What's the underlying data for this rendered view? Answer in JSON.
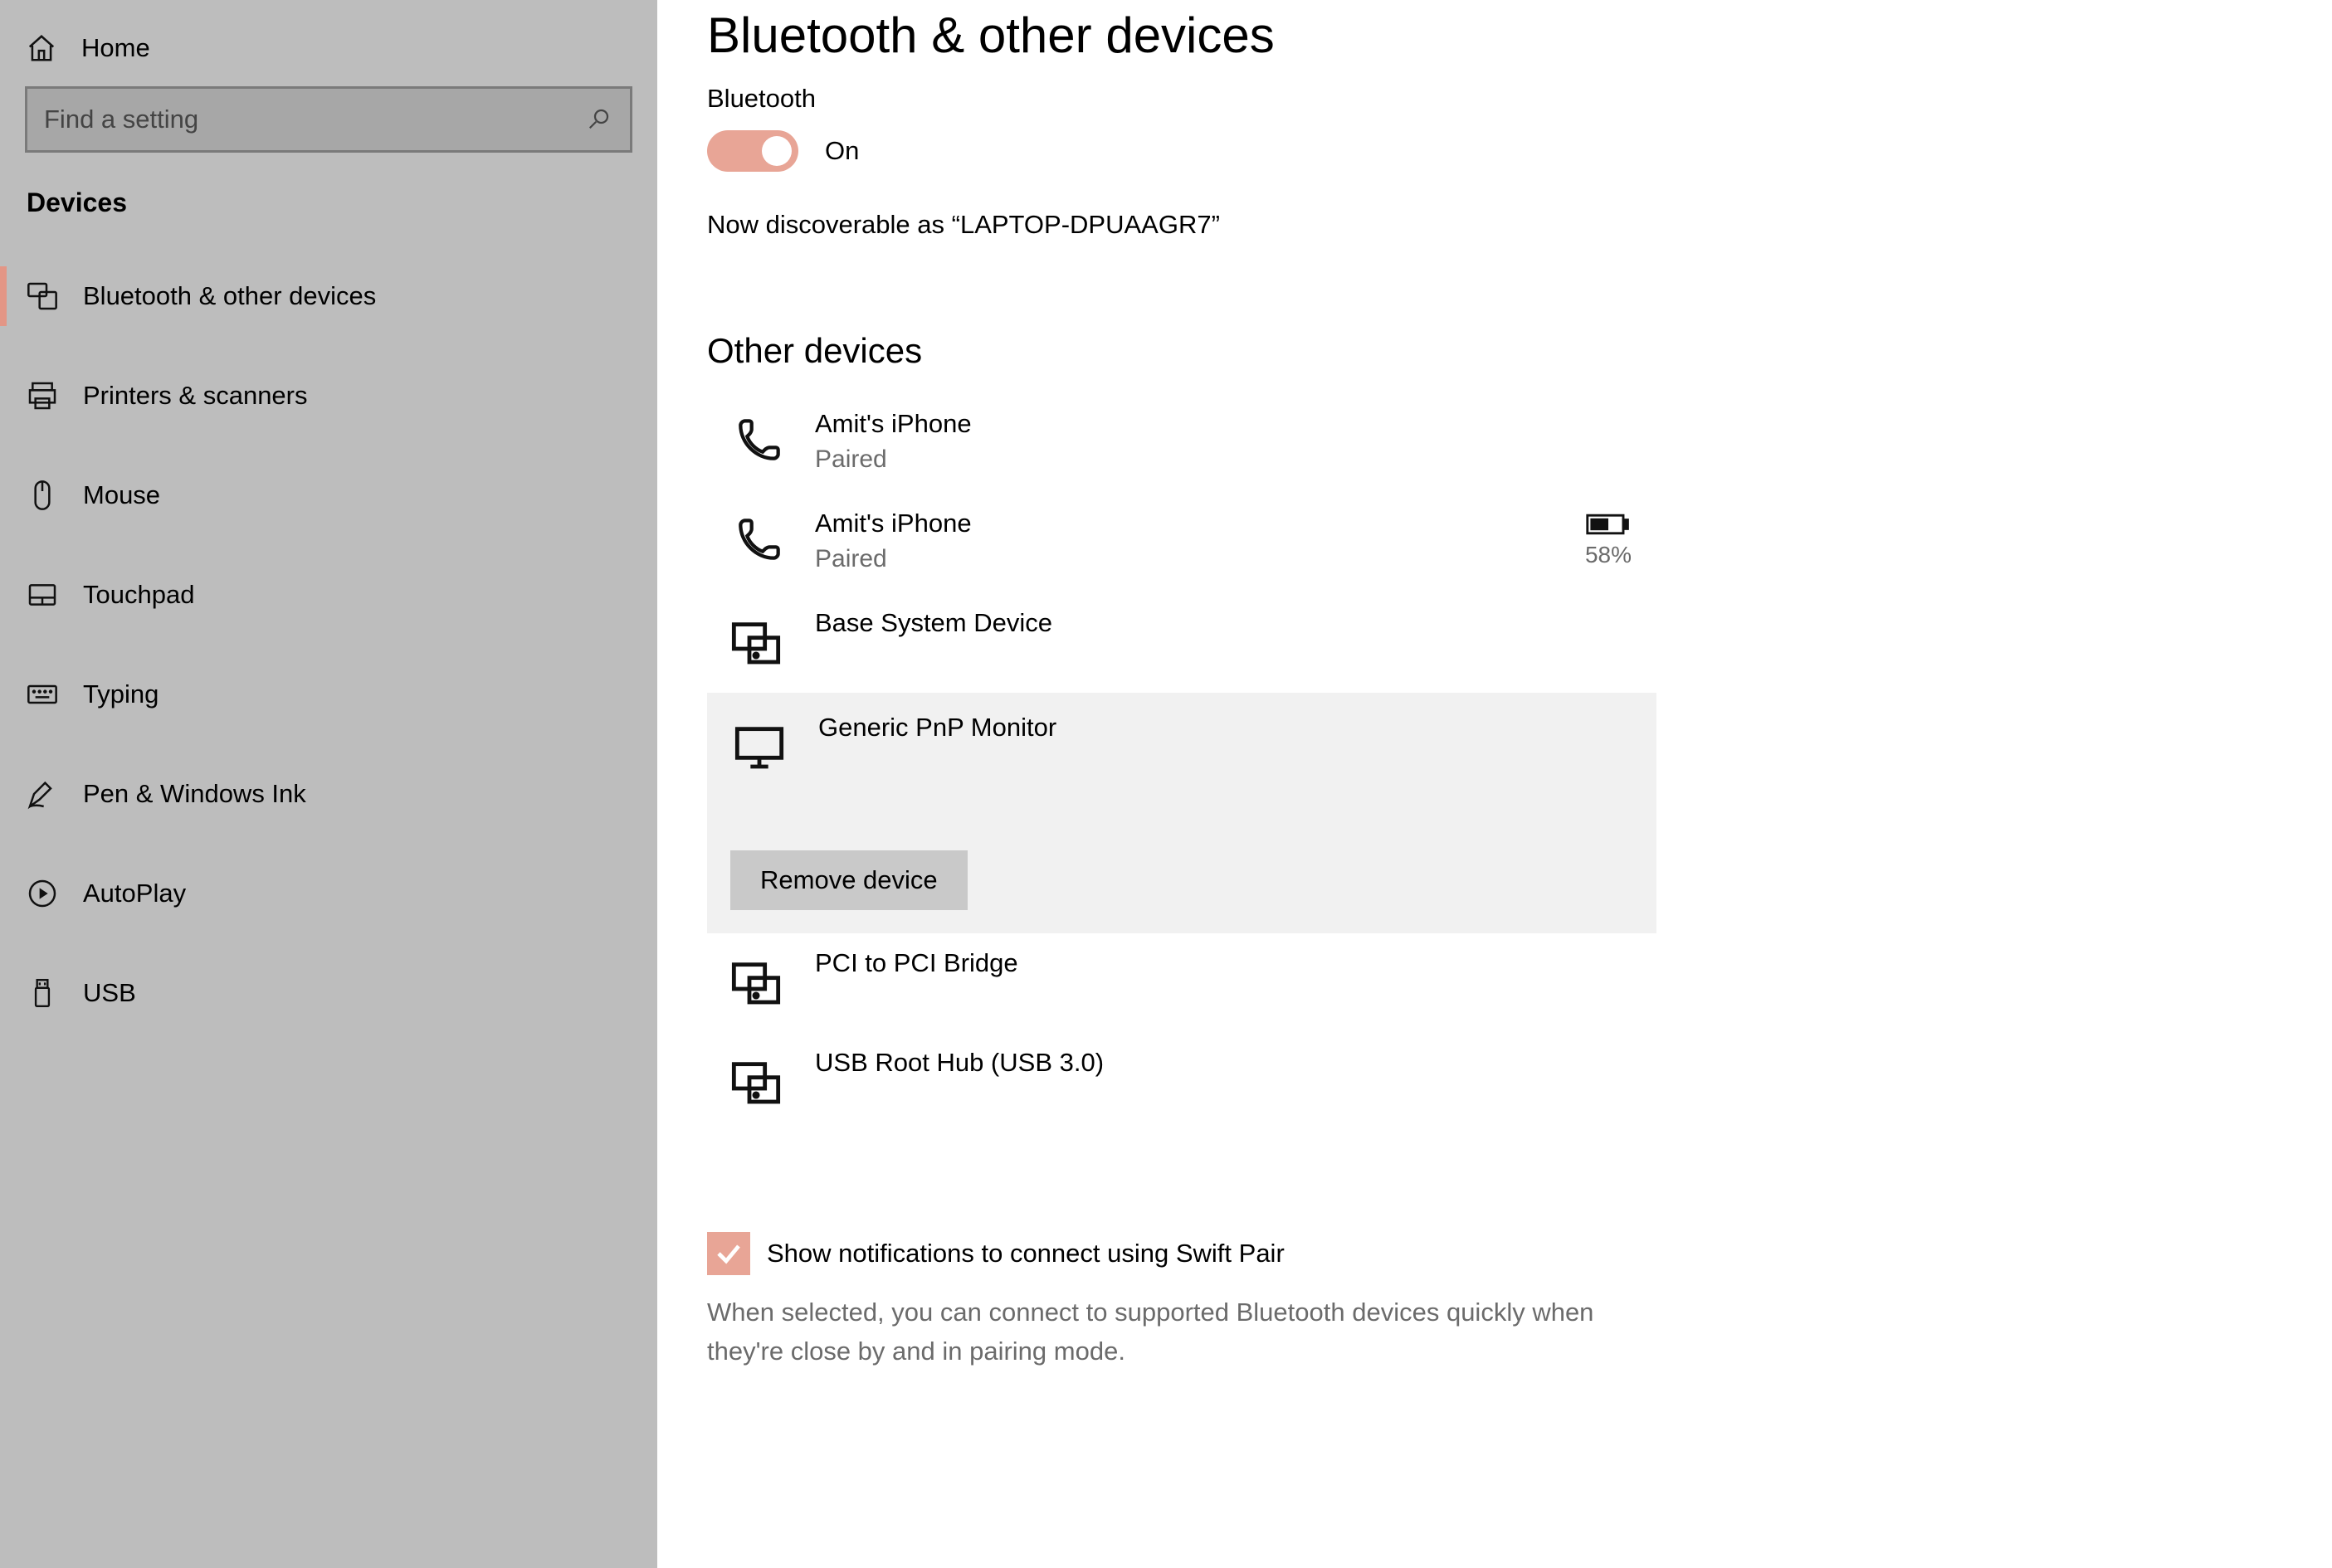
{
  "sidebar": {
    "home_label": "Home",
    "search_placeholder": "Find a setting",
    "section_title": "Devices",
    "items": [
      {
        "label": "Bluetooth & other devices"
      },
      {
        "label": "Printers & scanners"
      },
      {
        "label": "Mouse"
      },
      {
        "label": "Touchpad"
      },
      {
        "label": "Typing"
      },
      {
        "label": "Pen & Windows Ink"
      },
      {
        "label": "AutoPlay"
      },
      {
        "label": "USB"
      }
    ]
  },
  "main": {
    "page_title": "Bluetooth & other devices",
    "bluetooth_label": "Bluetooth",
    "toggle_state": "On",
    "discoverable_text": "Now discoverable as “LAPTOP-DPUAAGR7”",
    "other_devices_heading": "Other devices",
    "devices": [
      {
        "name": "Amit's iPhone",
        "status": "Paired",
        "icon": "phone",
        "battery": null,
        "selected": false
      },
      {
        "name": "Amit's iPhone",
        "status": "Paired",
        "icon": "phone",
        "battery": "58%",
        "selected": false
      },
      {
        "name": "Base System Device",
        "status": null,
        "icon": "device",
        "battery": null,
        "selected": false
      },
      {
        "name": "Generic PnP Monitor",
        "status": null,
        "icon": "monitor",
        "battery": null,
        "selected": true
      },
      {
        "name": "PCI to PCI Bridge",
        "status": null,
        "icon": "device",
        "battery": null,
        "selected": false
      },
      {
        "name": "USB Root Hub (USB 3.0)",
        "status": null,
        "icon": "device",
        "battery": null,
        "selected": false
      }
    ],
    "remove_button": "Remove device",
    "swift_pair_label": "Show notifications to connect using Swift Pair",
    "swift_pair_desc": "When selected, you can connect to supported Bluetooth devices quickly when they're close by and in pairing mode."
  }
}
